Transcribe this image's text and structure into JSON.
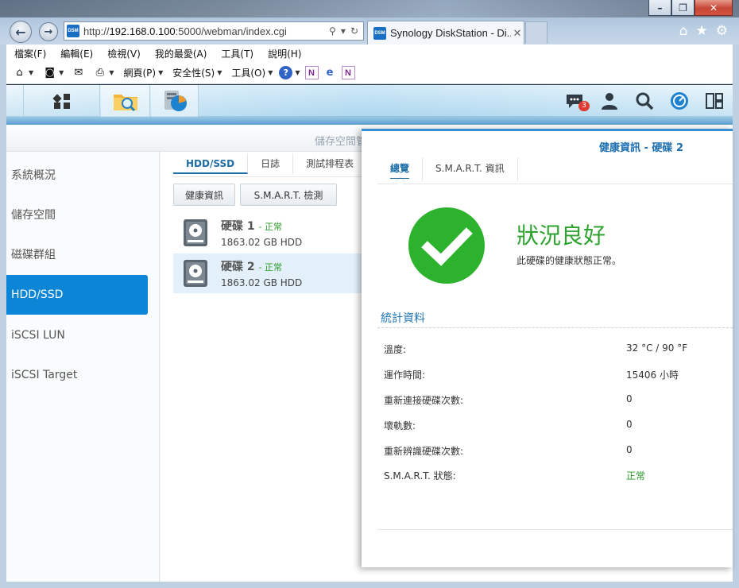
{
  "browser": {
    "url_prefix": "http://",
    "url_host": "192.168.0.100",
    "url_rest": ":5000/webman/index.cgi",
    "tab_title": "Synology DiskStation - Di...",
    "favicon_text": "DSM",
    "window_buttons": [
      "–",
      "❐",
      "✕"
    ],
    "menu": [
      "檔案(F)",
      "編輯(E)",
      "檢視(V)",
      "我的最愛(A)",
      "工具(T)",
      "說明(H)"
    ],
    "commands": {
      "page": "網頁(P)",
      "safety": "安全性(S)",
      "tools": "工具(O)"
    }
  },
  "dsm": {
    "notification_count": "3",
    "app_title": "儲存空間管",
    "sidebar": [
      {
        "label": "系統概況"
      },
      {
        "label": "儲存空間"
      },
      {
        "label": "磁碟群組"
      },
      {
        "label": "HDD/SSD",
        "active": true
      },
      {
        "label": "iSCSI LUN"
      },
      {
        "label": "iSCSI Target"
      }
    ],
    "tabs": [
      "HDD/SSD",
      "日誌",
      "測試排程表"
    ],
    "buttons": {
      "health": "健康資訊",
      "smart": "S.M.A.R.T. 檢測"
    },
    "disks": [
      {
        "name": "硬碟 1",
        "status": "- 正常",
        "size": "1863.02 GB HDD"
      },
      {
        "name": "硬碟 2",
        "status": "- 正常",
        "size": "1863.02 GB HDD",
        "selected": true
      }
    ]
  },
  "dialog": {
    "title": "健康資訊 - 硬碟 2",
    "tabs": [
      "總覽",
      "S.M.A.R.T. 資訊"
    ],
    "status_title": "狀況良好",
    "status_desc": "此硬碟的健康狀態正常。",
    "section_title": "統計資料",
    "stats": [
      {
        "label": "溫度:",
        "value": "32 °C / 90 °F"
      },
      {
        "label": "運作時間:",
        "value": "15406 小時"
      },
      {
        "label": "重新連接硬碟次數:",
        "value": "0"
      },
      {
        "label": "壞軌數:",
        "value": "0"
      },
      {
        "label": "重新辨識硬碟次數:",
        "value": "0"
      },
      {
        "label": "S.M.A.R.T. 狀態:",
        "value": "正常",
        "color": "#2a9a2a"
      }
    ]
  },
  "colors": {
    "accent": "#0b85d6",
    "ok_green": "#2db22d",
    "title_blue": "#1d6fb0"
  }
}
